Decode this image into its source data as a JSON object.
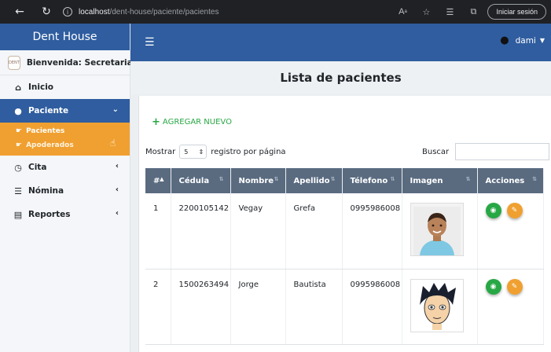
{
  "browser": {
    "url_host": "localhost",
    "url_path": "/dent-house/paciente/pacientes",
    "login_button": "Iniciar sesión"
  },
  "sidebar": {
    "brand": "Dent House",
    "welcome": "Bienvenida: Secretaria",
    "items": [
      {
        "label": "Inicio",
        "icon": "home-icon"
      },
      {
        "label": "Paciente",
        "icon": "user-icon",
        "active": true,
        "submenu": [
          {
            "label": "Pacientes",
            "icon": "hand-point-icon"
          },
          {
            "label": "Apoderados",
            "icon": "hand-point-icon"
          }
        ]
      },
      {
        "label": "Cita",
        "icon": "clock-icon"
      },
      {
        "label": "Nómina",
        "icon": "list-icon"
      },
      {
        "label": "Reportes",
        "icon": "file-icon"
      }
    ]
  },
  "header": {
    "username": "dami"
  },
  "main": {
    "title": "Lista de pacientes",
    "add_label": "AGREGAR NUEVO",
    "length_prefix": "Mostrar",
    "length_value": "5",
    "length_suffix": "registro por página",
    "search_label": "Buscar",
    "columns": [
      "#",
      "Cédula",
      "Nombre",
      "Apellido",
      "Télefono",
      "Imagen",
      "Acciones"
    ],
    "rows": [
      {
        "num": "1",
        "cedula": "2200105142",
        "nombre": "Vegay",
        "apellido": "Grefa",
        "telefono": "0995986008",
        "imagen": "child-photo"
      },
      {
        "num": "2",
        "cedula": "1500263494",
        "nombre": "Jorge",
        "apellido": "Bautista",
        "telefono": "0995986008",
        "imagen": "cartoon-avatar"
      }
    ]
  },
  "colors": {
    "primary": "#2f5d9f",
    "accent": "#f0a030",
    "success": "#28a745",
    "table_header": "#5a6b80"
  }
}
